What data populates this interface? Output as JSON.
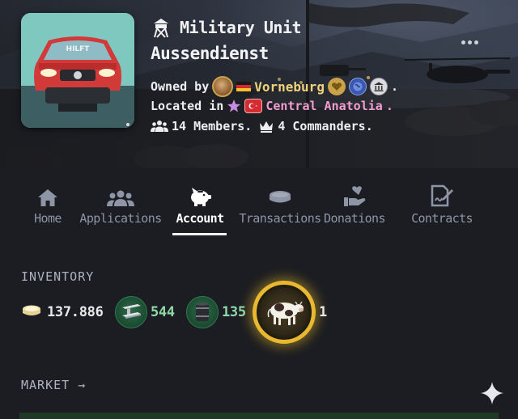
{
  "header": {
    "unit_type": "Military Unit",
    "unit_name": "Aussendienst",
    "owned_by_label": "Owned by",
    "owner_name": "Vorneburg",
    "owned_by_suffix": ".",
    "located_in_label": "Located in",
    "region_name": "Central Anatolia",
    "located_suffix": ".",
    "members_text": "14 Members.",
    "commanders_text": "4 Commanders.",
    "avatar_plate_text": "HILFT",
    "colors": {
      "owner_name": "#f0d27a",
      "region_name": "#f39ccf",
      "background": "#1c1d22"
    }
  },
  "tabs": [
    {
      "label": "Home",
      "icon": "home-icon"
    },
    {
      "label": "Applications",
      "icon": "users-icon"
    },
    {
      "label": "Account",
      "icon": "piggy-bank-icon",
      "active": true
    },
    {
      "label": "Transactions",
      "icon": "coins-icon"
    },
    {
      "label": "Donations",
      "icon": "hand-heart-icon"
    },
    {
      "label": "Contracts",
      "icon": "contract-sign-icon"
    }
  ],
  "inventory": {
    "title": "INVENTORY",
    "items": [
      {
        "name": "money",
        "icon": "coin-stack-icon",
        "value": "137.886"
      },
      {
        "name": "iron",
        "icon": "iron-beam-icon",
        "value": "544"
      },
      {
        "name": "oil",
        "icon": "oil-barrel-icon",
        "value": "135"
      },
      {
        "name": "cow",
        "icon": "cow-icon",
        "value": "1"
      }
    ]
  },
  "market": {
    "title": "MARKET",
    "arrow": "→"
  }
}
